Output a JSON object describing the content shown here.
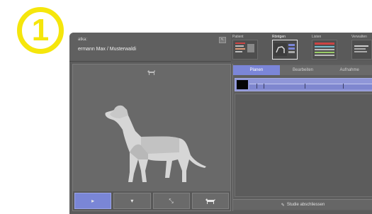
{
  "step_badge": "1",
  "patient": {
    "label": "atka:",
    "name": "ermann Max / Musterwaldi"
  },
  "modes": [
    {
      "label": "Patient",
      "active": false
    },
    {
      "label": "Röntgen",
      "active": true
    },
    {
      "label": "Listen",
      "active": false
    },
    {
      "label": "Verwalten",
      "active": false
    }
  ],
  "tabs": [
    {
      "label": "Planen",
      "active": true
    },
    {
      "label": "Bearbeiten",
      "active": false
    },
    {
      "label": "Aufnahme",
      "active": false
    }
  ],
  "finish_button": "Studie abschliessen",
  "view_buttons": [
    {
      "icon": "dog-head-lateral-icon",
      "active": true
    },
    {
      "icon": "dog-head-front-icon",
      "active": false
    },
    {
      "icon": "dog-limbs-icon",
      "active": false
    },
    {
      "icon": "dog-body-icon",
      "active": false
    }
  ],
  "colors": {
    "accent": "#7b86d8",
    "badge": "#f5e60c",
    "window_bg": "#5c5c5c"
  }
}
